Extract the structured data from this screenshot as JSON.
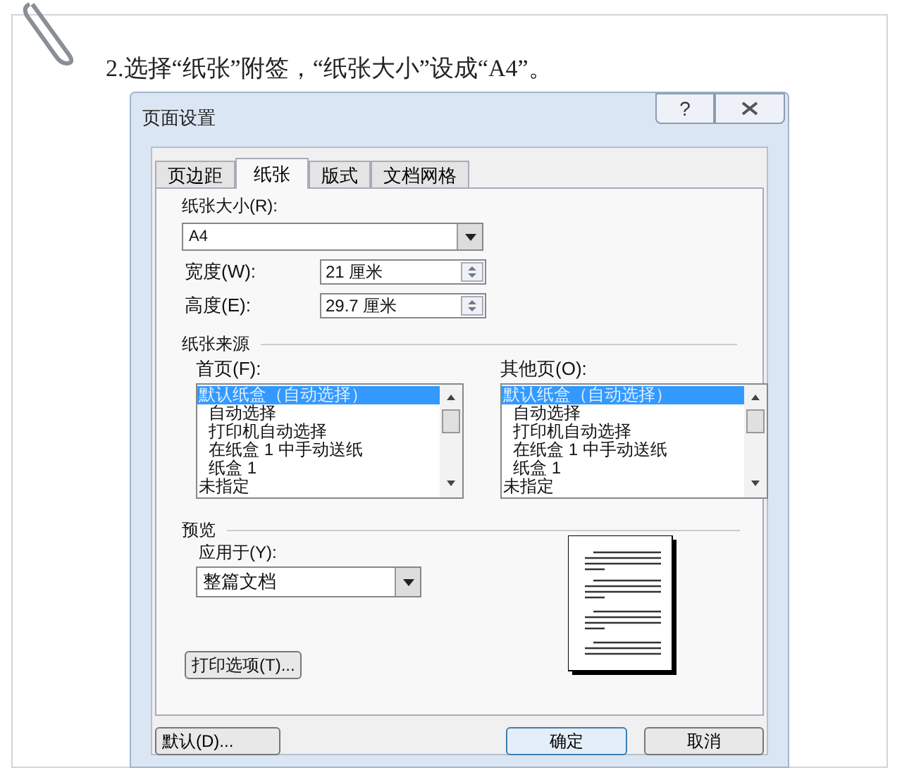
{
  "instruction": "2.选择“纸张”附签，“纸张大小”设成“A4”。",
  "dialog": {
    "title": "页面设置",
    "help_button": "?",
    "tabs": [
      {
        "label": "页边距",
        "selected": false
      },
      {
        "label": "纸张",
        "selected": true
      },
      {
        "label": "版式",
        "selected": false
      },
      {
        "label": "文档网格",
        "selected": false
      }
    ],
    "paper_size": {
      "label": "纸张大小(R):",
      "value": "A4"
    },
    "width": {
      "label": "宽度(W):",
      "value": "21 厘米"
    },
    "height": {
      "label": "高度(E):",
      "value": "29.7 厘米"
    },
    "paper_source": {
      "heading": "纸张来源",
      "lists": [
        {
          "label": "首页(F):",
          "items": [
            {
              "text": "默认纸盒（自动选择）",
              "selected": true,
              "indented": false
            },
            {
              "text": "自动选择",
              "selected": false,
              "indented": true
            },
            {
              "text": "打印机自动选择",
              "selected": false,
              "indented": true
            },
            {
              "text": "在纸盒 1 中手动送纸",
              "selected": false,
              "indented": true
            },
            {
              "text": "纸盒 1",
              "selected": false,
              "indented": true
            },
            {
              "text": "未指定",
              "selected": false,
              "indented": false
            }
          ]
        },
        {
          "label": "其他页(O):",
          "items": [
            {
              "text": "默认纸盒（自动选择）",
              "selected": true,
              "indented": false
            },
            {
              "text": "自动选择",
              "selected": false,
              "indented": true
            },
            {
              "text": "打印机自动选择",
              "selected": false,
              "indented": true
            },
            {
              "text": "在纸盒 1 中手动送纸",
              "selected": false,
              "indented": true
            },
            {
              "text": "纸盒 1",
              "selected": false,
              "indented": true
            },
            {
              "text": "未指定",
              "selected": false,
              "indented": false
            }
          ]
        }
      ]
    },
    "preview": {
      "heading": "预览",
      "apply_to": {
        "label": "应用于(Y):",
        "value": "整篇文档"
      }
    },
    "print_options_button": "打印选项(T)...",
    "default_button": "默认(D)...",
    "ok_button": "确定",
    "cancel_button": "取消"
  }
}
